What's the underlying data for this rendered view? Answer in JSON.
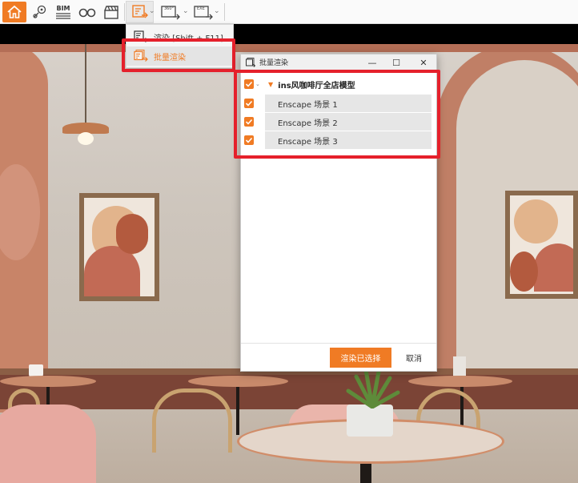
{
  "toolbar": {
    "bim_label": "BIM",
    "render_caret": "⌄",
    "panorama_caret": "⌄",
    "export_caret": "⌄",
    "panorama_icon_text": "360°",
    "export_icon_text": "EXE"
  },
  "menu": {
    "items": [
      {
        "label": "渲染 [Shift + F11]"
      },
      {
        "label": "批量渲染"
      }
    ]
  },
  "dialog": {
    "title": "批量渲染",
    "minimize": "—",
    "maximize": "☐",
    "close": "✕",
    "tree": {
      "root_label": "ins风咖啡厅全店模型",
      "children": [
        {
          "label": "Enscape 场景 1"
        },
        {
          "label": "Enscape 场景 2"
        },
        {
          "label": "Enscape 场景 3"
        }
      ]
    },
    "buttons": {
      "render_selected": "渲染已选择",
      "cancel": "取消"
    }
  },
  "colors": {
    "accent": "#f07b24",
    "highlight": "#e5202b"
  }
}
